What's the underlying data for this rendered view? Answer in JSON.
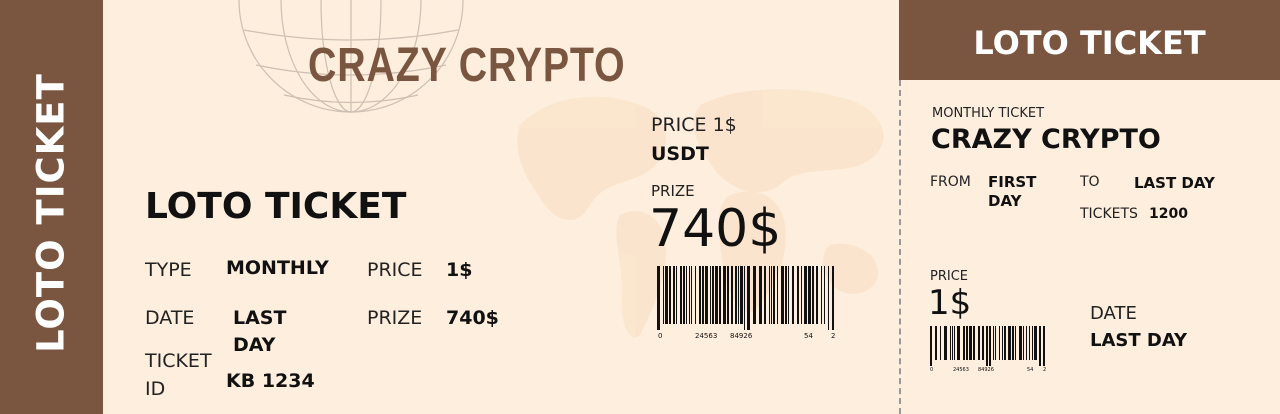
{
  "side_label": "LOTO TICKET",
  "brand": "CRAZY CRYPTO",
  "main": {
    "title": "LOTO TICKET",
    "type_label": "TYPE",
    "type_value": "MONTHLY",
    "price_label": "PRICE",
    "price_value": "1$",
    "date_label": "DATE",
    "date_value_line1": "LAST",
    "date_value_line2": "DAY",
    "prize_label": "PRIZE",
    "prize_value": "740$",
    "ticket_id_label_line1": "TICKET",
    "ticket_id_label_line2": "ID",
    "ticket_id_value": "KB 1234"
  },
  "middle": {
    "price_label": "PRICE 1$",
    "price_currency": "USDT",
    "prize_label": "PRIZE",
    "prize_value": "740$",
    "barcode_numbers": [
      "0",
      "24563",
      "84926",
      "54",
      "2"
    ]
  },
  "stub": {
    "header": "LOTO TICKET",
    "subtitle": "MONTHLY TICKET",
    "title": "CRAZY CRYPTO",
    "from_label": "FROM",
    "from_value_line1": "FIRST",
    "from_value_line2": "DAY",
    "to_label": "TO",
    "to_value": "LAST DAY",
    "tickets_label": "TICKETS",
    "tickets_value": "1200",
    "price_label": "PRICE",
    "price_value": "1$",
    "date_label": "DATE",
    "date_value": "LAST DAY",
    "barcode_numbers": [
      "0",
      "24563",
      "84926",
      "54",
      "2"
    ]
  },
  "colors": {
    "brown": "#7a5540",
    "cream": "#fdeedd"
  }
}
